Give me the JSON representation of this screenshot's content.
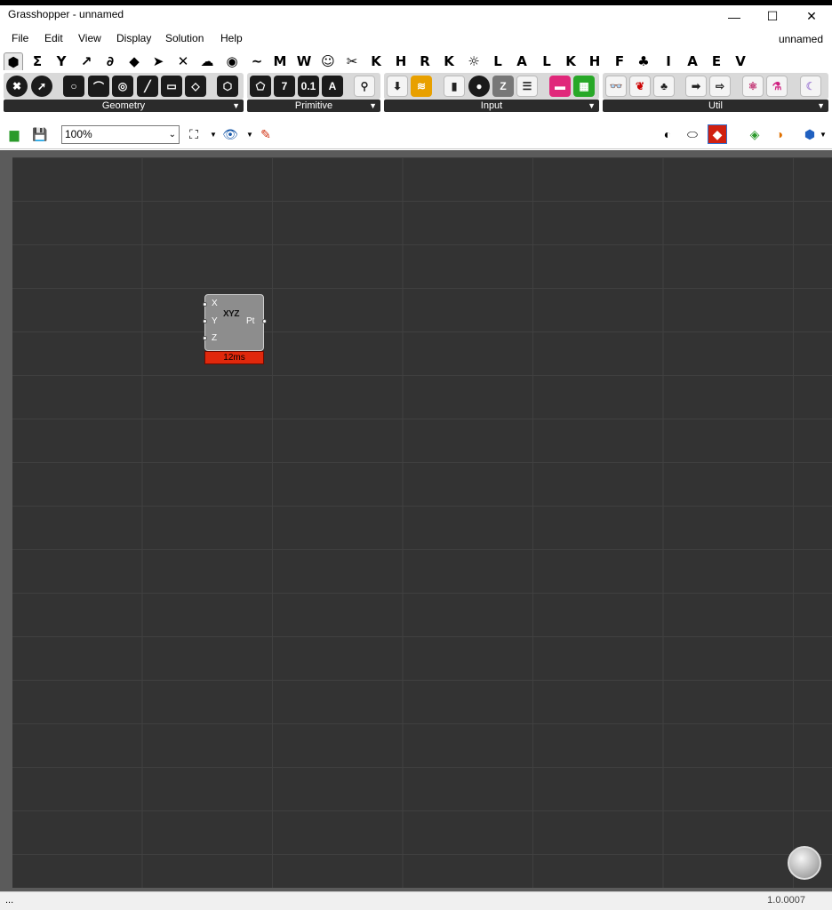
{
  "window": {
    "title": "Grasshopper - unnamed",
    "document_name": "unnamed"
  },
  "menu": [
    "File",
    "Edit",
    "View",
    "Display",
    "Solution",
    "Help"
  ],
  "tabs": [
    "Σ",
    "Y",
    "↗",
    "∂",
    "◆",
    "➤",
    "✕",
    "☁",
    "◉",
    "~",
    "M",
    "W",
    "☺",
    "✂",
    "K",
    "H",
    "R",
    "K",
    "☼",
    "L",
    "A",
    "L",
    "K",
    "H",
    "F",
    "♣",
    "I",
    "A",
    "E",
    "V"
  ],
  "ribbon": {
    "geometry_label": "Geometry",
    "primitive_label": "Primitive",
    "input_label": "Input",
    "util_label": "Util"
  },
  "toolbar": {
    "zoom": "100%"
  },
  "component": {
    "inputs": [
      "X",
      "Y",
      "Z"
    ],
    "output": "Pt",
    "icon_text": "XYZ",
    "time": "12ms"
  },
  "status": {
    "left": "...",
    "version": "1.0.0007"
  }
}
